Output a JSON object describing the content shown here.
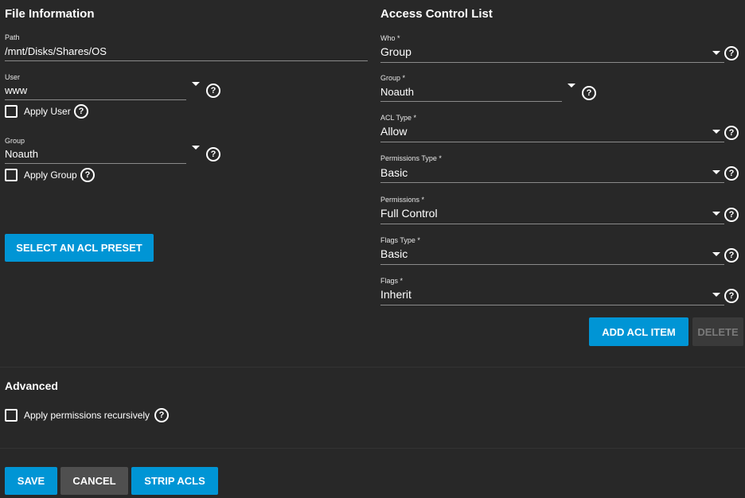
{
  "file_info": {
    "title": "File Information",
    "path": {
      "label": "Path",
      "value": "/mnt/Disks/Shares/OS"
    },
    "user": {
      "label": "User",
      "value": "www",
      "apply_label": "Apply User"
    },
    "group": {
      "label": "Group",
      "value": "Noauth",
      "apply_label": "Apply Group"
    },
    "preset_button": "SELECT AN ACL PRESET"
  },
  "acl": {
    "title": "Access Control List",
    "who": {
      "label": "Who *",
      "value": "Group"
    },
    "group": {
      "label": "Group *",
      "value": "Noauth"
    },
    "acl_type": {
      "label": "ACL Type *",
      "value": "Allow"
    },
    "permissions_type": {
      "label": "Permissions Type *",
      "value": "Basic"
    },
    "permissions": {
      "label": "Permissions *",
      "value": "Full Control"
    },
    "flags_type": {
      "label": "Flags Type *",
      "value": "Basic"
    },
    "flags": {
      "label": "Flags *",
      "value": "Inherit"
    },
    "add_button": "ADD ACL ITEM",
    "delete_button": "DELETE"
  },
  "advanced": {
    "title": "Advanced",
    "recursive_label": "Apply permissions recursively"
  },
  "footer": {
    "save": "SAVE",
    "cancel": "CANCEL",
    "strip": "STRIP ACLS"
  },
  "icons": {
    "help": "help-circle-icon",
    "dropdown": "caret-down-icon",
    "checkbox": "checkbox-unchecked-icon"
  },
  "colors": {
    "background": "#282828",
    "primary": "#0095d5",
    "secondary_button": "#4f4f4f",
    "disabled_button": "#3a3a3a"
  }
}
